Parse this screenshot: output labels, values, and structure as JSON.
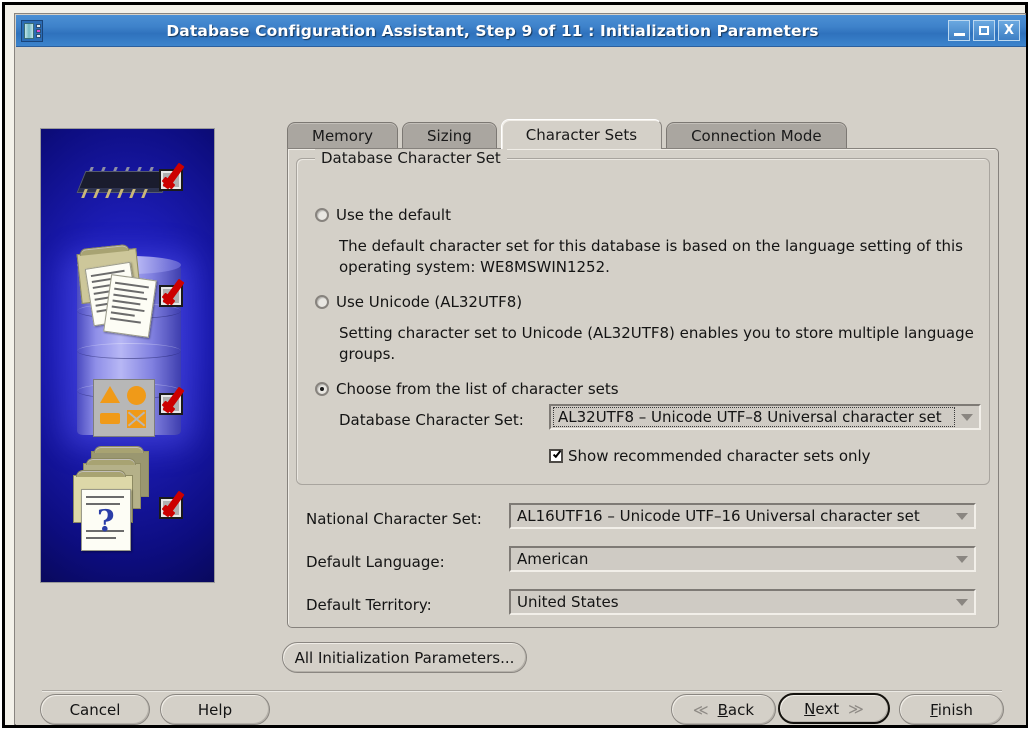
{
  "window": {
    "title": "Database Configuration Assistant, Step 9 of 11 : Initialization Parameters",
    "icon": "database-server-icon",
    "minimize_label": "–",
    "maximize_label": "□",
    "close_label": "X"
  },
  "tabs": [
    {
      "label": "Memory",
      "active": false
    },
    {
      "label": "Sizing",
      "active": false
    },
    {
      "label": "Character Sets",
      "active": true
    },
    {
      "label": "Connection Mode",
      "active": false
    }
  ],
  "group": {
    "title": "Database Character Set",
    "options": [
      {
        "label": "Use the default",
        "selected": false
      },
      {
        "label": "Use Unicode (AL32UTF8)",
        "selected": false
      },
      {
        "label": "Choose from the list of character sets",
        "selected": true
      }
    ],
    "default_description": "The default character set for this database is based on the language setting of this operating system: WE8MSWIN1252.",
    "unicode_description": "Setting character set to Unicode (AL32UTF8) enables you to store multiple language groups.",
    "db_charset_label": "Database Character Set:",
    "db_charset_value": "AL32UTF8 – Unicode UTF–8 Universal character set",
    "recommended_checkbox_label": "Show recommended character sets only",
    "recommended_checked": true
  },
  "fields": [
    {
      "label": "National Character Set:",
      "value": "AL16UTF16 – Unicode UTF–16 Universal character set"
    },
    {
      "label": "Default Language:",
      "value": "American"
    },
    {
      "label": "Default Territory:",
      "value": "United States"
    }
  ],
  "buttons": {
    "all_params": "All Initialization Parameters...",
    "cancel": "Cancel",
    "help": "Help",
    "back": "Back",
    "back_mnemonic": "B",
    "back_rest": "ack",
    "next": "Next",
    "next_mnemonic": "N",
    "next_rest": "ext",
    "finish": "Finish",
    "finish_mnemonic": "F",
    "finish_rest": "inish",
    "back_chevron": "≪",
    "next_chevron": "≫"
  },
  "sidebar": {
    "alt": "database-configuration-illustration",
    "question_mark": "?",
    "checkmark_count": 4
  },
  "colors": {
    "titlebar": "#3f83cb",
    "face": "#d4d0c8",
    "illustration": "#1c1cb4",
    "checkmark": "#cc0000",
    "accent_orange": "#f09a18"
  }
}
